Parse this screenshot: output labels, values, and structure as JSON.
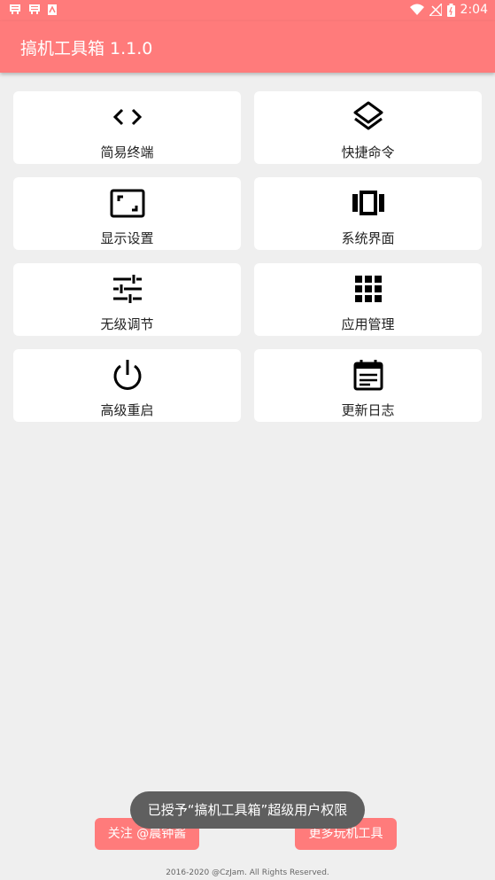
{
  "statusbar": {
    "time": "2:04",
    "left_icons": [
      "app-notification-icon",
      "app-notification-icon",
      "download-icon"
    ],
    "right_icons": [
      "wifi-icon",
      "no-signal-icon",
      "battery-icon"
    ]
  },
  "appbar": {
    "title": "搞机工具箱 1.1.0"
  },
  "tools": [
    {
      "label": "简易终端",
      "icon": "code-icon"
    },
    {
      "label": "快捷命令",
      "icon": "layers-icon"
    },
    {
      "label": "显示设置",
      "icon": "aspect-ratio-icon"
    },
    {
      "label": "系统界面",
      "icon": "view-carousel-icon"
    },
    {
      "label": "无级调节",
      "icon": "tune-icon"
    },
    {
      "label": "应用管理",
      "icon": "apps-grid-icon"
    },
    {
      "label": "高级重启",
      "icon": "power-icon"
    },
    {
      "label": "更新日志",
      "icon": "calendar-log-icon"
    }
  ],
  "buttons": {
    "follow": "关注 @晨钟酱",
    "more_tools": "更多玩机工具"
  },
  "toast": "已授予“搞机工具箱”超级用户权限",
  "footer": "2016-2020 @CzJam. All Rights Reserved.",
  "colors": {
    "accent": "#ff7b7b",
    "background": "#efefef",
    "card": "#ffffff",
    "toast": "#5f5f5f"
  }
}
